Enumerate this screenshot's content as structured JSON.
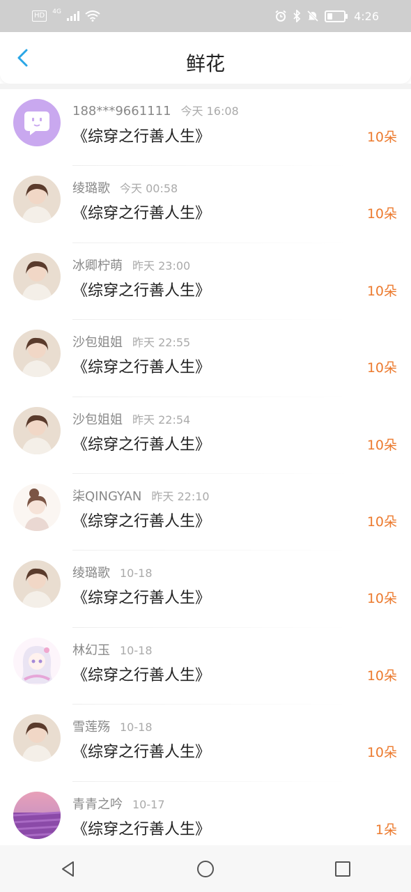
{
  "status_bar": {
    "left_tag": "HD",
    "network": "4G",
    "time": "4:26",
    "icons": [
      "signal-icon",
      "wifi-icon",
      "alarm-icon",
      "bluetooth-icon",
      "mute-icon",
      "battery-icon"
    ]
  },
  "header": {
    "title": "鲜花",
    "back_icon": "chevron-left-icon"
  },
  "colors": {
    "accent": "#ec7a2e",
    "back": "#2aa6e6"
  },
  "items": [
    {
      "name": "188***9661111",
      "time": "今天 16:08",
      "book": "《综穿之行善人生》",
      "count": "10朵",
      "avatar": "chat-bubble-avatar"
    },
    {
      "name": "绫璐歌",
      "time": "今天 00:58",
      "book": "《综穿之行善人生》",
      "count": "10朵",
      "avatar": "photo-avatar"
    },
    {
      "name": "冰卿柠萌",
      "time": "昨天 23:00",
      "book": "《综穿之行善人生》",
      "count": "10朵",
      "avatar": "photo-avatar"
    },
    {
      "name": "沙包姐姐",
      "time": "昨天 22:55",
      "book": "《综穿之行善人生》",
      "count": "10朵",
      "avatar": "photo-avatar"
    },
    {
      "name": "沙包姐姐",
      "time": "昨天 22:54",
      "book": "《综穿之行善人生》",
      "count": "10朵",
      "avatar": "photo-avatar"
    },
    {
      "name": "柒QINGYAN",
      "time": "昨天 22:10",
      "book": "《综穿之行善人生》",
      "count": "10朵",
      "avatar": "illustration-avatar"
    },
    {
      "name": "绫璐歌",
      "time": "10-18",
      "book": "《综穿之行善人生》",
      "count": "10朵",
      "avatar": "photo-avatar"
    },
    {
      "name": "林幻玉",
      "time": "10-18",
      "book": "《综穿之行善人生》",
      "count": "10朵",
      "avatar": "anime-avatar"
    },
    {
      "name": "雪莲殇",
      "time": "10-18",
      "book": "《综穿之行善人生》",
      "count": "10朵",
      "avatar": "photo-avatar"
    },
    {
      "name": "青青之吟",
      "time": "10-17",
      "book": "《综穿之行善人生》",
      "count": "1朵",
      "avatar": "lavender-field-avatar"
    }
  ],
  "nav": {
    "back": "triangle-back-icon",
    "home": "circle-home-icon",
    "recent": "square-recent-icon"
  }
}
